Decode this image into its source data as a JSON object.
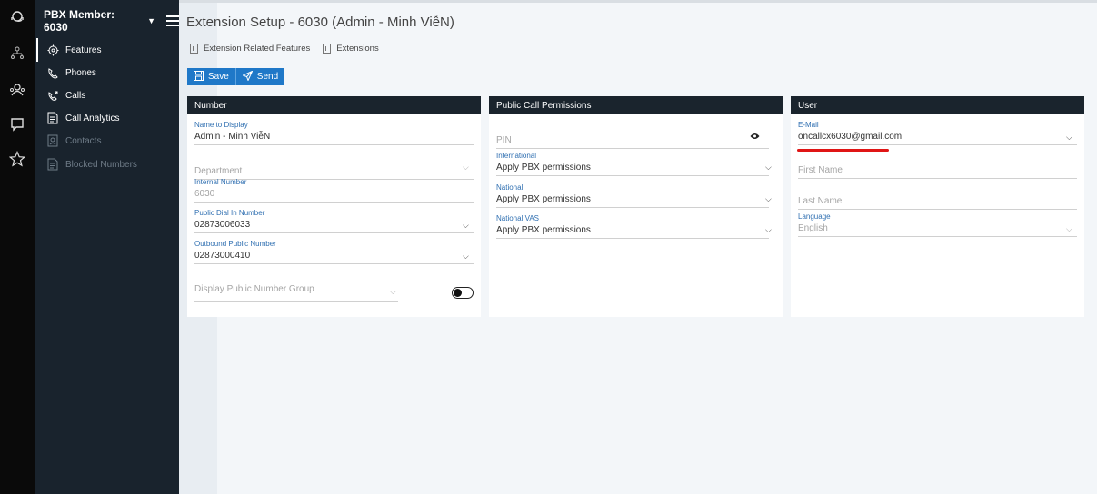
{
  "header": {
    "member_label": "PBX Member: 6030"
  },
  "sidebar": {
    "items": [
      {
        "label": "Features",
        "icon": "features-icon"
      },
      {
        "label": "Phones",
        "icon": "phone-icon"
      },
      {
        "label": "Calls",
        "icon": "calls-icon"
      },
      {
        "label": "Call Analytics",
        "icon": "analytics-icon"
      },
      {
        "label": "Contacts",
        "icon": "contacts-icon"
      },
      {
        "label": "Blocked Numbers",
        "icon": "blocked-icon"
      }
    ]
  },
  "page": {
    "title": "Extension Setup - 6030 (Admin - Minh ViễN)",
    "tabs": [
      "Extension Related Features",
      "Extensions"
    ],
    "save_label": "Save",
    "send_label": "Send"
  },
  "number_panel": {
    "title": "Number",
    "name_label": "Name to Display",
    "name_value": "Admin - Minh ViễN",
    "department_placeholder": "Department",
    "internal_label": "Internal Number",
    "internal_value": "6030",
    "dialin_label": "Public Dial In Number",
    "dialin_value": "02873006033",
    "outbound_label": "Outbound Public Number",
    "outbound_value": "02873000410",
    "group_placeholder": "Display Public Number Group"
  },
  "permissions_panel": {
    "title": "Public Call Permissions",
    "pin_placeholder": "PIN",
    "international_label": "International",
    "international_value": "Apply PBX permissions",
    "national_label": "National",
    "national_value": "Apply PBX permissions",
    "vas_label": "National VAS",
    "vas_value": "Apply PBX permissions"
  },
  "user_panel": {
    "title": "User",
    "email_label": "E-Mail",
    "email_value": "oncallcx6030@gmail.com",
    "first_name_placeholder": "First Name",
    "last_name_placeholder": "Last Name",
    "language_label": "Language",
    "language_value": "English"
  },
  "colors": {
    "accent": "#1f78c8",
    "sidebar_bg": "#19232d",
    "rail_bg": "#0a0a0a",
    "panel_head": "#1a242d",
    "field_label": "#2f6fb1",
    "annotation": "#e01515"
  }
}
